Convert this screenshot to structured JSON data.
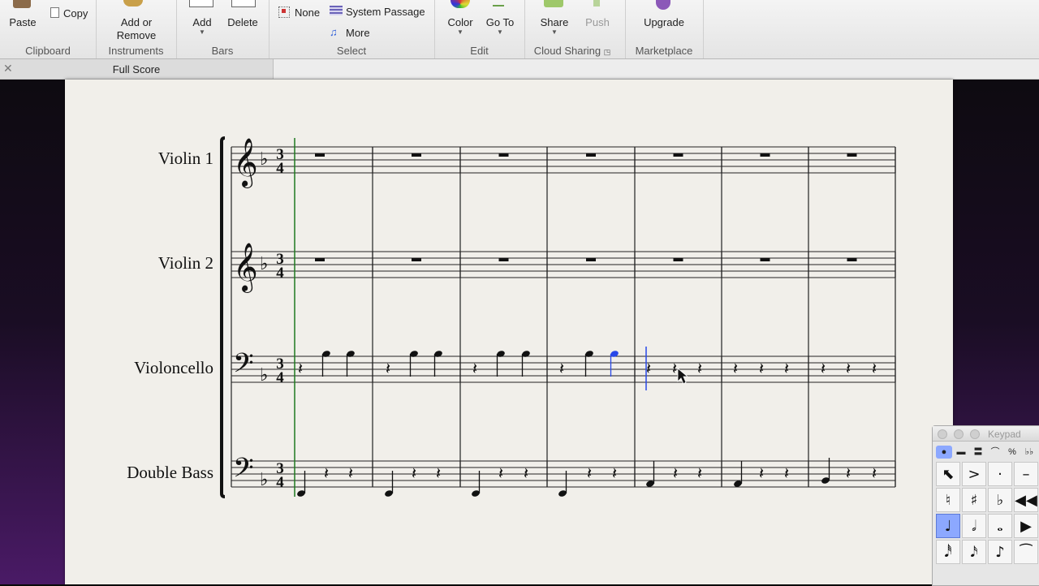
{
  "ribbon": {
    "clipboard": {
      "paste": "Paste",
      "copy": "Copy",
      "label": "Clipboard"
    },
    "instruments": {
      "add_remove": "Add or\nRemove",
      "label": "Instruments"
    },
    "bars": {
      "add": "Add",
      "delete": "Delete",
      "label": "Bars"
    },
    "select": {
      "none": "None",
      "system_passage": "System Passage",
      "more": "More",
      "label": "Select"
    },
    "edit": {
      "color": "Color",
      "goto": "Go To",
      "label": "Edit"
    },
    "cloud": {
      "share": "Share",
      "push": "Push",
      "label": "Cloud Sharing"
    },
    "marketplace": {
      "upgrade": "Upgrade",
      "label": "Marketplace"
    }
  },
  "tab": {
    "label": "Full Score"
  },
  "score": {
    "time_signature": {
      "top": "3",
      "bottom": "4"
    },
    "instruments": [
      "Violin 1",
      "Violin 2",
      "Violoncello",
      "Double Bass"
    ]
  },
  "keypad": {
    "title": "Keypad",
    "rows": [
      [
        "⬉",
        ">",
        "·",
        "–"
      ],
      [
        "♮",
        "♯",
        "♭",
        "◀◀"
      ],
      [
        "♩",
        "𝅗𝅥",
        "𝅝",
        "▶"
      ],
      [
        "𝅘𝅥𝅰",
        "𝅘𝅥𝅯",
        "♪",
        "⁀"
      ]
    ]
  },
  "colors": {
    "selection": "#2848e8",
    "playline": "#1f7a1f",
    "accent": "#8ca8ff"
  }
}
